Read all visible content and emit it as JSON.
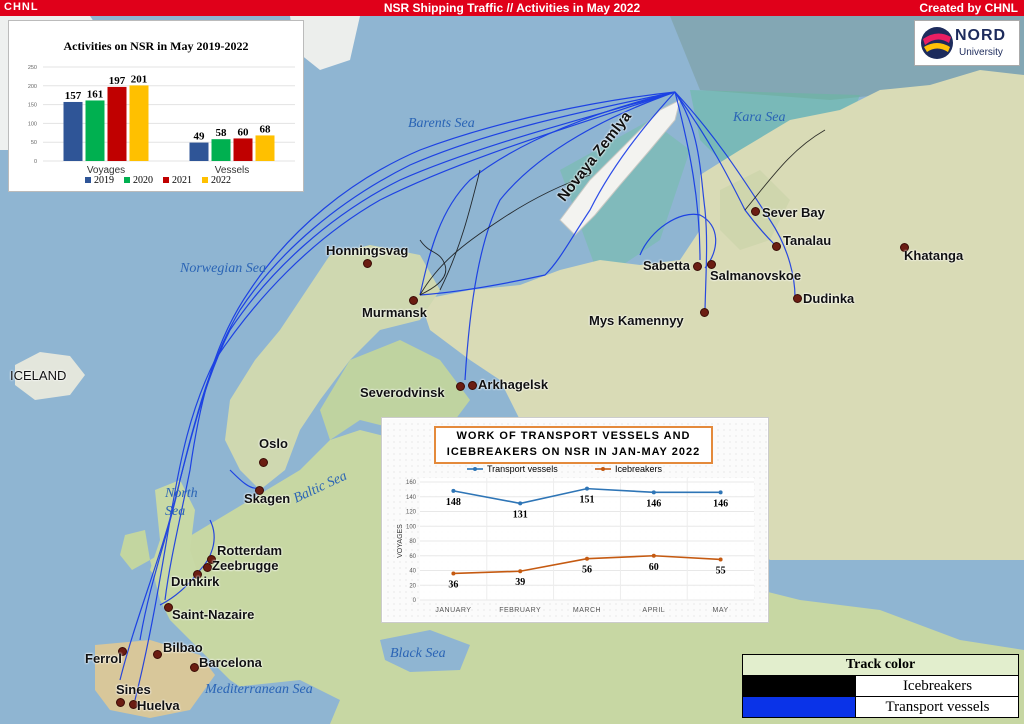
{
  "header": {
    "logo": "CHNL",
    "title": "NSR Shipping Traffic //  Activities in May 2022",
    "credit": "Created by CHNL"
  },
  "nord_logo": {
    "name": "NORD",
    "sub": "University"
  },
  "seas": {
    "barents": "Barents Sea",
    "kara": "Kara Sea",
    "norwegian": "Norwegian Sea",
    "north": "North Sea",
    "baltic": "Baltic Sea",
    "black": "Black Sea",
    "mediterranean": "Mediterranean Sea",
    "novaya": "Novaya Zemlya",
    "iceland": "ICELAND"
  },
  "ports": {
    "honningsvag": "Honningsvag",
    "murmansk": "Murmansk",
    "severodvinsk": "Severodvinsk",
    "arkhagelsk": "Arkhagelsk",
    "sabetta": "Sabetta",
    "salmanovskoe": "Salmanovskoe",
    "mys": "Mys Kamennyy",
    "sever_bay": "Sever Bay",
    "tanalau": "Tanalau",
    "dudinka": "Dudinka",
    "khatanga": "Khatanga",
    "oslo": "Oslo",
    "skagen": "Skagen",
    "rotterdam": "Rotterdam",
    "zeebrugge": "Zeebrugge",
    "dunkirk": "Dunkirk",
    "saint_nazaire": "Saint-Nazaire",
    "ferrol": "Ferrol",
    "bilbao": "Bilbao",
    "barcelona": "Barcelona",
    "sines": "Sines",
    "huelva": "Huelva"
  },
  "chart_data": [
    {
      "type": "bar",
      "title": "Activities on NSR in May 2019-2022",
      "categories": [
        "Voyages",
        "Vessels"
      ],
      "series": [
        {
          "name": "2019",
          "color": "#2f5597",
          "values": [
            157,
            49
          ]
        },
        {
          "name": "2020",
          "color": "#00b050",
          "values": [
            161,
            58
          ]
        },
        {
          "name": "2021",
          "color": "#c00000",
          "values": [
            197,
            60
          ]
        },
        {
          "name": "2022",
          "color": "#ffc000",
          "values": [
            201,
            68
          ]
        }
      ],
      "ylim": [
        0,
        250
      ],
      "yticks": [
        "0",
        "50",
        "100",
        "150",
        "200",
        "250"
      ],
      "grid": true,
      "legend": "bottom"
    },
    {
      "type": "line",
      "title": "WORK OF TRANSPORT VESSELS AND ICEBREAKERS ON NSR IN JAN-MAY 2022",
      "categories": [
        "JANUARY",
        "FEBRUARY",
        "MARCH",
        "APRIL",
        "MAY"
      ],
      "series": [
        {
          "name": "Transport vessels",
          "color": "#2e75b6",
          "values": [
            148,
            131,
            151,
            146,
            146
          ]
        },
        {
          "name": "Icebreakers",
          "color": "#c55a11",
          "values": [
            36,
            39,
            56,
            60,
            55
          ]
        }
      ],
      "ylabel": "VOYAGES",
      "ylim": [
        0,
        160
      ],
      "yticks": [
        "0",
        "20",
        "40",
        "60",
        "80",
        "100",
        "120",
        "140",
        "160"
      ],
      "grid": true,
      "legend": "top"
    }
  ],
  "legend": {
    "title": "Track color",
    "items": [
      {
        "label": "Icebreakers",
        "color": "#000000"
      },
      {
        "label": "Transport vessels",
        "color": "#0a33e8"
      }
    ]
  }
}
